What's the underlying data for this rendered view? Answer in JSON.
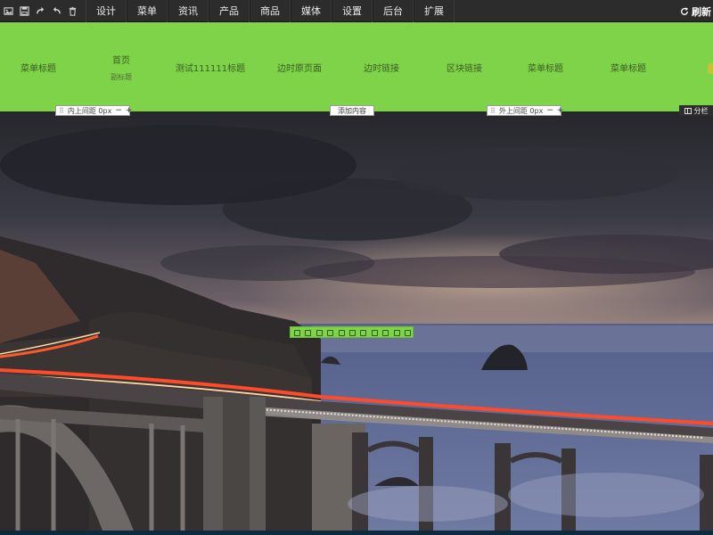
{
  "toolbar": {
    "icons": [
      "image-icon",
      "save-icon",
      "redo-icon",
      "undo-icon",
      "trash-icon"
    ],
    "menu": [
      "设计",
      "菜单",
      "资讯",
      "产品",
      "商品",
      "媒体",
      "设置",
      "后台",
      "扩展"
    ],
    "refresh_label": "刷新"
  },
  "nav": {
    "items": [
      {
        "label": "菜单标题",
        "sub": ""
      },
      {
        "label": "首页",
        "sub": "副标题"
      },
      {
        "label": "测试111111标题",
        "sub": ""
      },
      {
        "label": "边时原页面",
        "sub": ""
      },
      {
        "label": "边时链接",
        "sub": ""
      },
      {
        "label": "区块链接",
        "sub": ""
      },
      {
        "label": "菜单标题",
        "sub": ""
      },
      {
        "label": "菜单标题",
        "sub": ""
      }
    ],
    "background_color": "#7ed348"
  },
  "controls": {
    "inner_padding": "内上间距 0px",
    "add_content": "添加内容",
    "outer_padding": "外上间距 0px",
    "columns": "分栏",
    "minus": "−",
    "plus": "+"
  },
  "element_toolbar": {
    "icons": [
      "drag-icon",
      "resize-icon",
      "edit-icon",
      "settings-icon",
      "style-icon",
      "link-icon",
      "align-left-icon",
      "align-center-icon",
      "align-right-icon",
      "copy-icon",
      "delete-icon"
    ]
  },
  "hero": {
    "image": "coastal-bridge-sunset-photo"
  }
}
